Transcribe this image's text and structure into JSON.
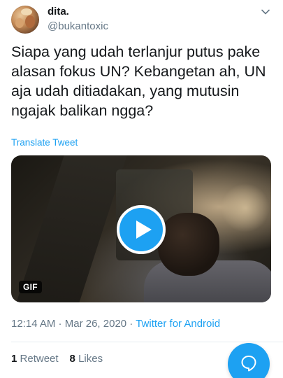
{
  "author": {
    "display_name": "dita.",
    "handle": "@bukantoxic"
  },
  "tweet": {
    "text": "Siapa yang udah terlanjur putus pake alasan fokus UN? Kebangetan ah, UN aja udah ditiadakan, yang mutusin ngajak balikan ngga?",
    "translate_label": "Translate Tweet"
  },
  "media": {
    "badge": "GIF"
  },
  "meta": {
    "time": "12:14 AM",
    "separator1": " · ",
    "date": "Mar 26, 2020",
    "separator2": " · ",
    "source": "Twitter for Android"
  },
  "stats": {
    "retweets_count": "1",
    "retweets_label": "Retweet",
    "likes_count": "8",
    "likes_label": "Likes"
  },
  "colors": {
    "accent": "#1da1f2",
    "text_primary": "#14171a",
    "text_secondary": "#657786"
  },
  "icons": {
    "chevron": "chevron-down-icon",
    "play": "play-icon",
    "compose": "reply-compose-icon"
  }
}
